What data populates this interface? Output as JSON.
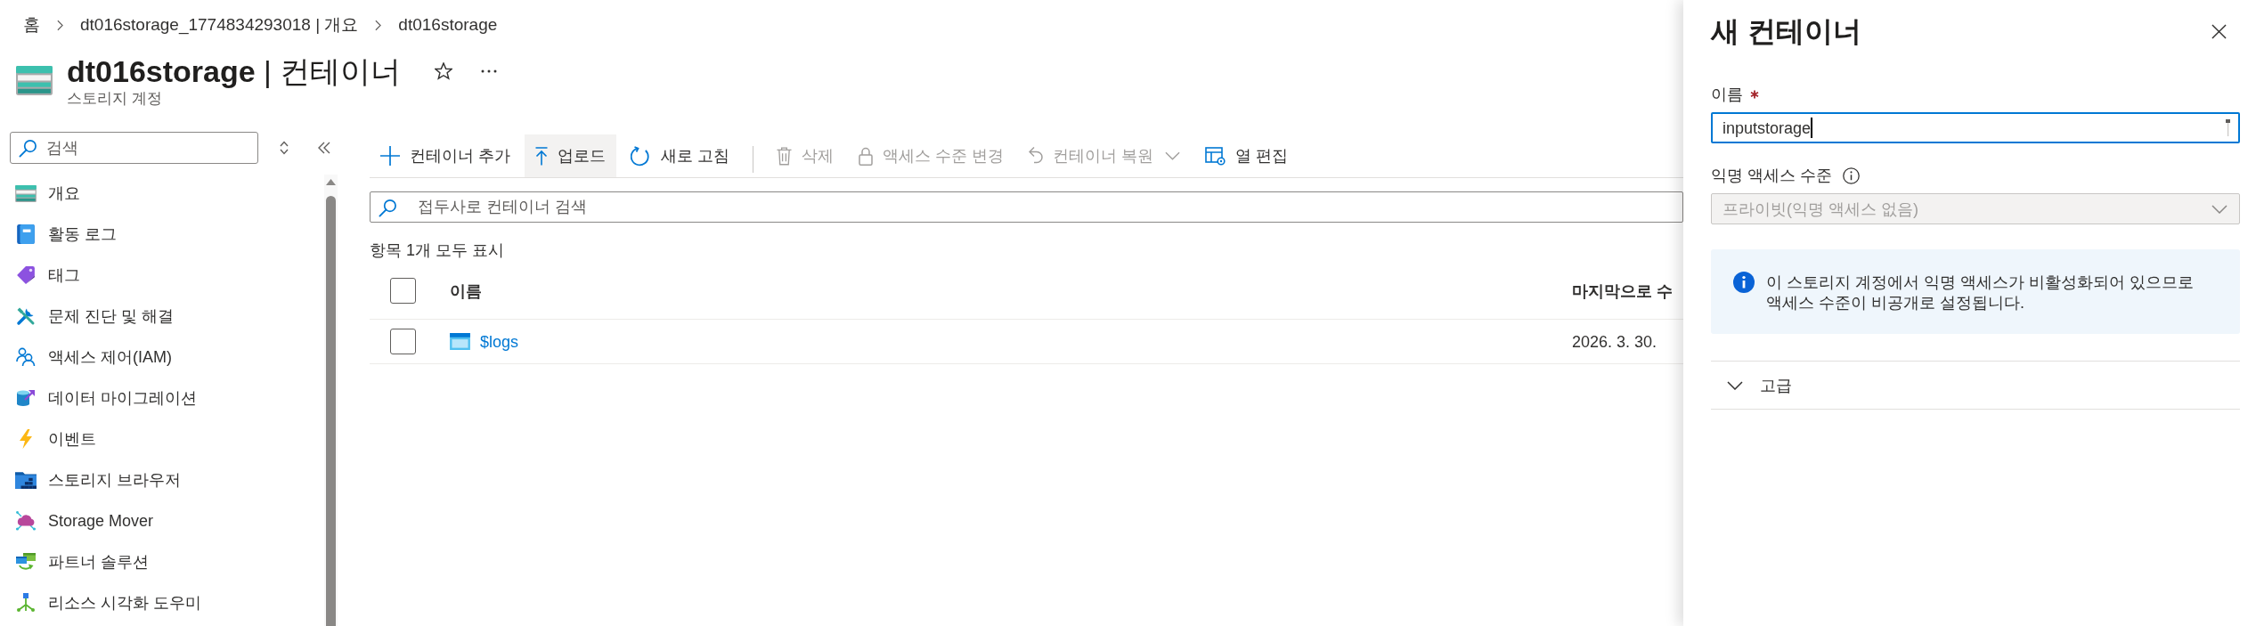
{
  "breadcrumb": [
    {
      "label": "홈"
    },
    {
      "label": "dt016storage_1774834293018 | 개요"
    },
    {
      "label": "dt016storage"
    }
  ],
  "header": {
    "title": "**dt016storage** | 컨테이너",
    "subtitle": "스토리지 계정",
    "favorite": false
  },
  "sidebar": {
    "search": {
      "placeholder": "검색"
    },
    "items": [
      {
        "label": "개요",
        "selected": false
      },
      {
        "label": "활동 로그",
        "selected": false
      },
      {
        "label": "태그",
        "selected": false
      },
      {
        "label": "문제 진단 및 해결",
        "selected": false
      },
      {
        "label": "액세스 제어(IAM)",
        "selected": false
      },
      {
        "label": "데이터 마이그레이션",
        "selected": false
      },
      {
        "label": "이벤트",
        "selected": false
      },
      {
        "label": "스토리지 브라우저",
        "selected": false
      },
      {
        "label": "Storage Mover",
        "selected": false
      },
      {
        "label": "파트너 솔루션",
        "selected": false
      },
      {
        "label": "리소스 시각화 도우미",
        "selected": false
      }
    ]
  },
  "toolbar": [
    {
      "items": [
        {
          "label": "컨테이너 추가",
          "disabled": false,
          "hovered": false,
          "dropdown": false
        },
        {
          "label": "업로드",
          "disabled": false,
          "hovered": true,
          "dropdown": false
        },
        {
          "label": "새로 고침",
          "disabled": false,
          "hovered": false,
          "dropdown": false
        }
      ]
    },
    {
      "items": [
        {
          "label": "삭제",
          "disabled": true,
          "hovered": false,
          "dropdown": false
        },
        {
          "label": "액세스 수준 변경",
          "disabled": true,
          "hovered": false,
          "dropdown": false
        },
        {
          "label": "컨테이너 복원",
          "disabled": true,
          "hovered": false,
          "dropdown": true
        },
        {
          "label": "열 편집",
          "disabled": false,
          "hovered": false,
          "dropdown": false
        }
      ]
    }
  ],
  "search": {
    "placeholder": "접두사로 컨테이너 검색"
  },
  "item_count": "항목 1개 모두 표시",
  "table": {
    "all_checked": false,
    "columns": [
      {
        "label": "이름"
      },
      {
        "label": "마지막으로 수"
      }
    ],
    "rows": [
      {
        "checked": false,
        "cells": [
          "$logs",
          "2026. 3. 30."
        ]
      }
    ]
  },
  "panel": {
    "title": "새 컨테이너",
    "fields": [
      {
        "kind": "text",
        "label": "이름",
        "required": true,
        "info": false,
        "focused": true,
        "disabled": false,
        "value": "inputstorage"
      },
      {
        "kind": "select",
        "label": "익명 액세스 수준",
        "required": false,
        "info": true,
        "focused": false,
        "disabled": true,
        "value": "프라이빗(익명 액세스 없음)"
      }
    ],
    "notice": "이 스토리지 계정에서 익명 액세스가 비활성화되어 있으므로 액세스 수준이 비공개로 설정됩니다.",
    "sections": [
      {
        "label": "고급",
        "expanded": false
      }
    ]
  }
}
